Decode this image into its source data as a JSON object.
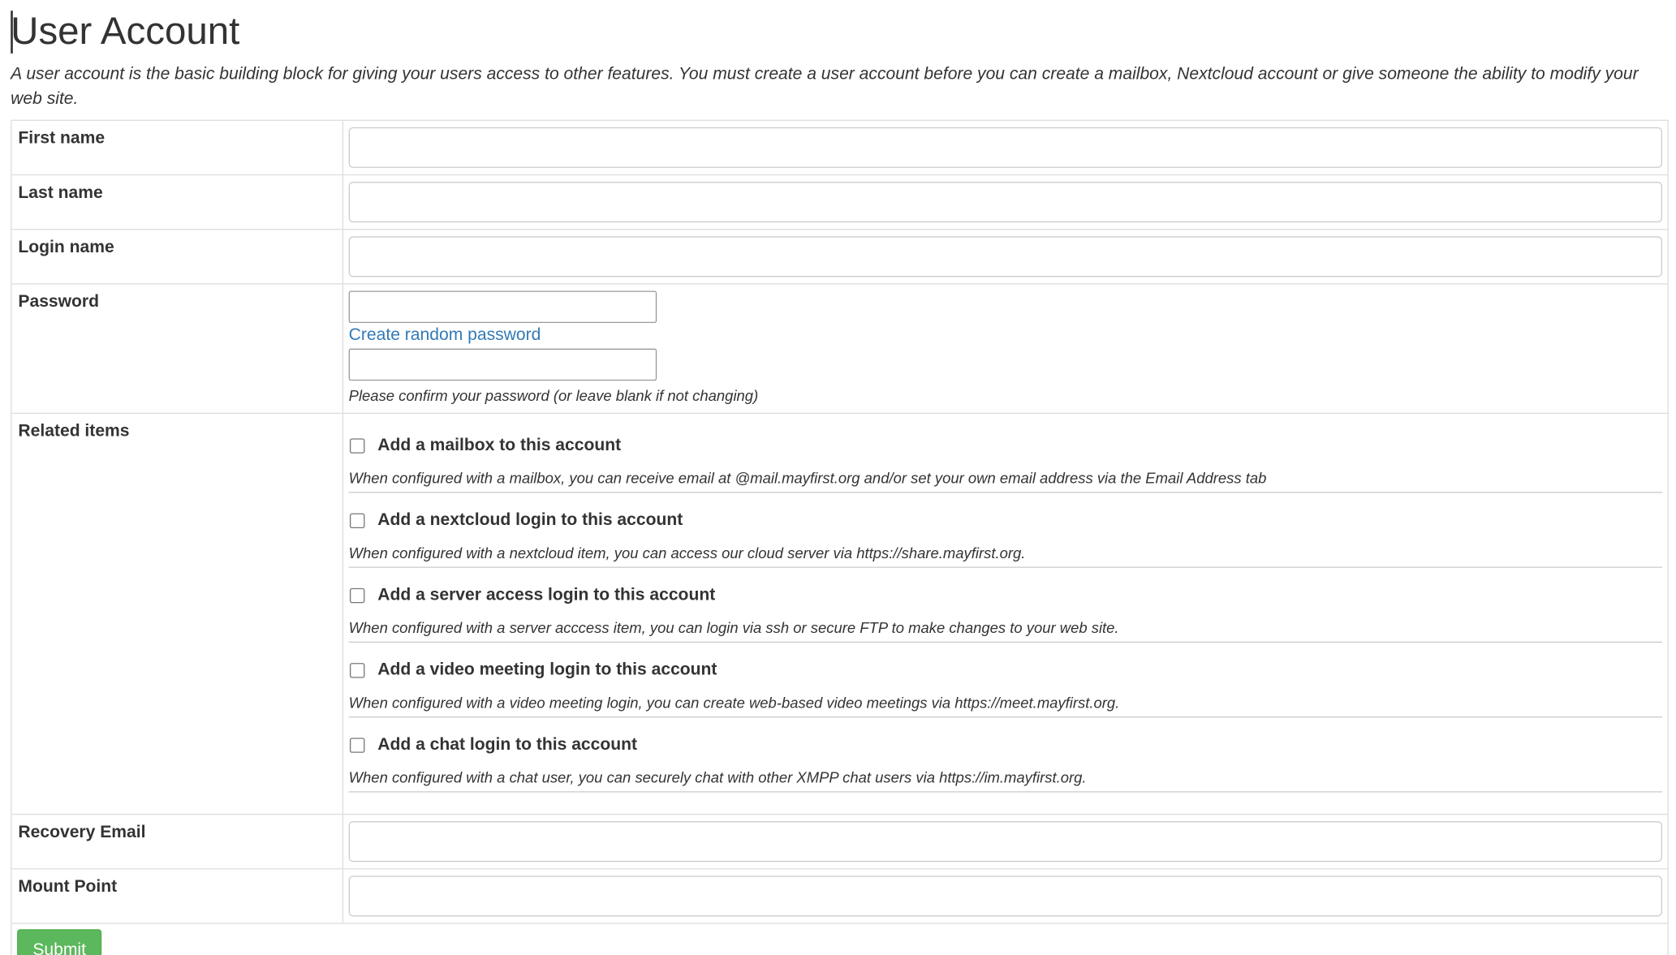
{
  "page": {
    "title": "User Account",
    "intro": "A user account is the basic building block for giving your users access to other features. You must create a user account before you can create a mailbox, Nextcloud account or give someone the ability to modify your web site."
  },
  "form": {
    "first_name": {
      "label": "First name",
      "value": ""
    },
    "last_name": {
      "label": "Last name",
      "value": ""
    },
    "login_name": {
      "label": "Login name",
      "value": ""
    },
    "password": {
      "label": "Password",
      "value": "",
      "random_link": "Create random password",
      "confirm_value": "",
      "confirm_help": "Please confirm your password (or leave blank if not changing)"
    },
    "related": {
      "label": "Related items",
      "items": [
        {
          "label": "Add a mailbox to this account",
          "checked": false,
          "help": "When configured with a mailbox, you can receive email at @mail.mayfirst.org and/or set your own email address via the Email Address tab"
        },
        {
          "label": "Add a nextcloud login to this account",
          "checked": false,
          "help": "When configured with a nextcloud item, you can access our cloud server via https://share.mayfirst.org."
        },
        {
          "label": "Add a server access login to this account",
          "checked": false,
          "help": "When configured with a server acccess item, you can login via ssh or secure FTP to make changes to your web site."
        },
        {
          "label": "Add a video meeting login to this account",
          "checked": false,
          "help": "When configured with a video meeting login, you can create web-based video meetings via https://meet.mayfirst.org."
        },
        {
          "label": "Add a chat login to this account",
          "checked": false,
          "help": "When configured with a chat user, you can securely chat with other XMPP chat users via https://im.mayfirst.org."
        }
      ]
    },
    "recovery_email": {
      "label": "Recovery Email",
      "value": ""
    },
    "mount_point": {
      "label": "Mount Point",
      "value": ""
    },
    "submit_label": "Submit"
  },
  "colors": {
    "link": "#337ab7",
    "submit": "#5cb85c",
    "border": "#dddddd"
  }
}
